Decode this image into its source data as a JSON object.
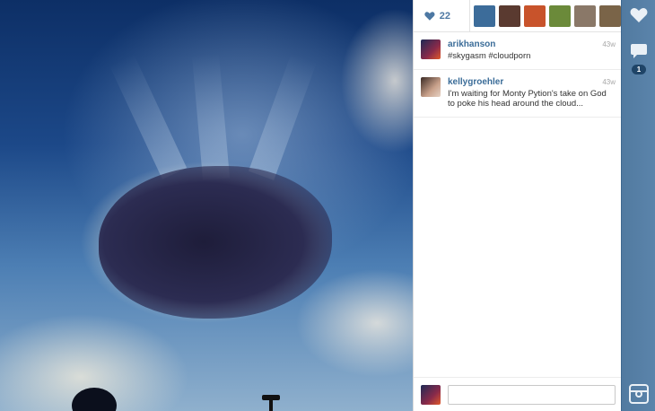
{
  "likes": {
    "count": "22",
    "avatars": [
      {
        "name": "liker-1",
        "color": "#3c6c9a"
      },
      {
        "name": "liker-2",
        "color": "#5a3a30"
      },
      {
        "name": "liker-3",
        "color": "#c8532b"
      },
      {
        "name": "liker-4",
        "color": "#6b8a3a"
      },
      {
        "name": "liker-5",
        "color": "#8a7868"
      },
      {
        "name": "liker-6",
        "color": "#7a6448"
      }
    ]
  },
  "comments": [
    {
      "username": "arikhanson",
      "text": "#skygasm #cloudporn",
      "time": "43w",
      "avatar_color": "#6a2a4a"
    },
    {
      "username": "kellygroehler",
      "text": "I'm waiting for Monty Pytion's take on God to poke his head around the cloud...",
      "time": "43w",
      "avatar_color": "#8a6a5a"
    }
  ],
  "comment_input": {
    "placeholder": "",
    "value": ""
  },
  "actions": {
    "comment_count": "1"
  },
  "icons": [
    "heart-icon",
    "comment-icon",
    "camera-icon"
  ],
  "colors": {
    "accent": "#4d78a3",
    "sidebar": "#5580a8"
  }
}
